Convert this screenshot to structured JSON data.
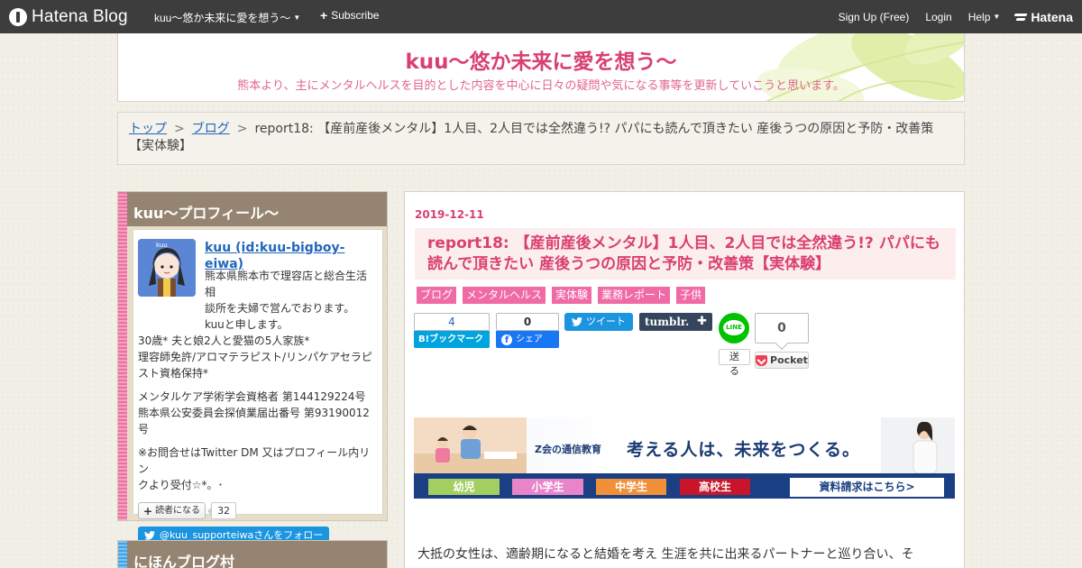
{
  "global_header": {
    "logo_text": "Hatena Blog",
    "blog_name": "kuu～悠か未来に愛を想う～",
    "subscribe_label": "Subscribe",
    "signup_label": "Sign Up (Free)",
    "login_label": "Login",
    "help_label": "Help",
    "hatena_label": "Hatena"
  },
  "blog": {
    "title": "kuu～悠か未来に愛を想う～",
    "description": "熊本より、主にメンタルヘルスを目的とした内容を中心に日々の疑問や気になる事等を更新していこうと思います。"
  },
  "breadcrumb": {
    "top": "トップ",
    "separator": ">",
    "category": "ブログ",
    "current": "report18: 【産前産後メンタル】1人目、2人目では全然違う!? パパにも読んで頂きたい 産後うつの原因と予防・改善策【実体験】"
  },
  "sidebar": {
    "profile": {
      "heading": "kuu～プロフィール～",
      "avatar_text": "kuu",
      "name": "kuu (id:kuu-bigboy-eiwa)",
      "lines_indented": [
        "熊本県熊本市で理容店と総合生活相",
        "談所を夫婦で営んでおります。",
        "kuuと申します。"
      ],
      "lines": [
        "30歳* 夫と娘2人と愛猫の5人家族*",
        "理容師免許/アロマテラピスト/リンパケアセラピ",
        "スト資格保持*"
      ],
      "license_lines": [
        "メンタルケア学術学会資格者 第144129224号",
        "熊本県公安委員会探偵業届出番号 第93190012号"
      ],
      "contact_lines": [
        "※お問合せはTwitter DM 又はプロフィール内リン",
        "クより受付☆*。･"
      ],
      "reader_button": "読者になる",
      "reader_count": "32",
      "twitter_follow": "@kuu_supporteiwaさんをフォロー"
    },
    "village": {
      "heading": "にほんブログ村"
    }
  },
  "article": {
    "date": "2019-12-11",
    "title": "report18: 【産前産後メンタル】1人目、2人目では全然違う!? パパにも読んで頂きたい 産後うつの原因と予防・改善策【実体験】",
    "categories": [
      "ブログ",
      "メンタルヘルス",
      "実体験",
      "業務レポート",
      "子供"
    ],
    "share": {
      "hatena_count": "4",
      "hatena_label": "B!ブックマーク",
      "facebook_count": "0",
      "facebook_label": "シェア",
      "facebook_icon": "f",
      "tweet_label": "ツイート",
      "tumblr_label": "tumblr.",
      "line_icon_text": "LINE",
      "line_label": "送る",
      "pocket_count": "0",
      "pocket_label": "Pocket"
    },
    "ad": {
      "brand": "Z会の通信教育",
      "headline": "考える人は、未来をつくる。",
      "tags": [
        "幼児",
        "小学生",
        "中学生",
        "高校生"
      ],
      "cta": "資料請求はこちら>"
    },
    "body_first_line": "大抵の女性は、適齢期になると結婚を考え 生涯を共に出来るパートナーと巡り合い、そ"
  },
  "colors": {
    "accent_pink": "#d94070",
    "category_pink": "#f06aa6",
    "header_dark": "#3d3d3d",
    "module_brown": "#958471",
    "link_blue": "#2266bb"
  }
}
